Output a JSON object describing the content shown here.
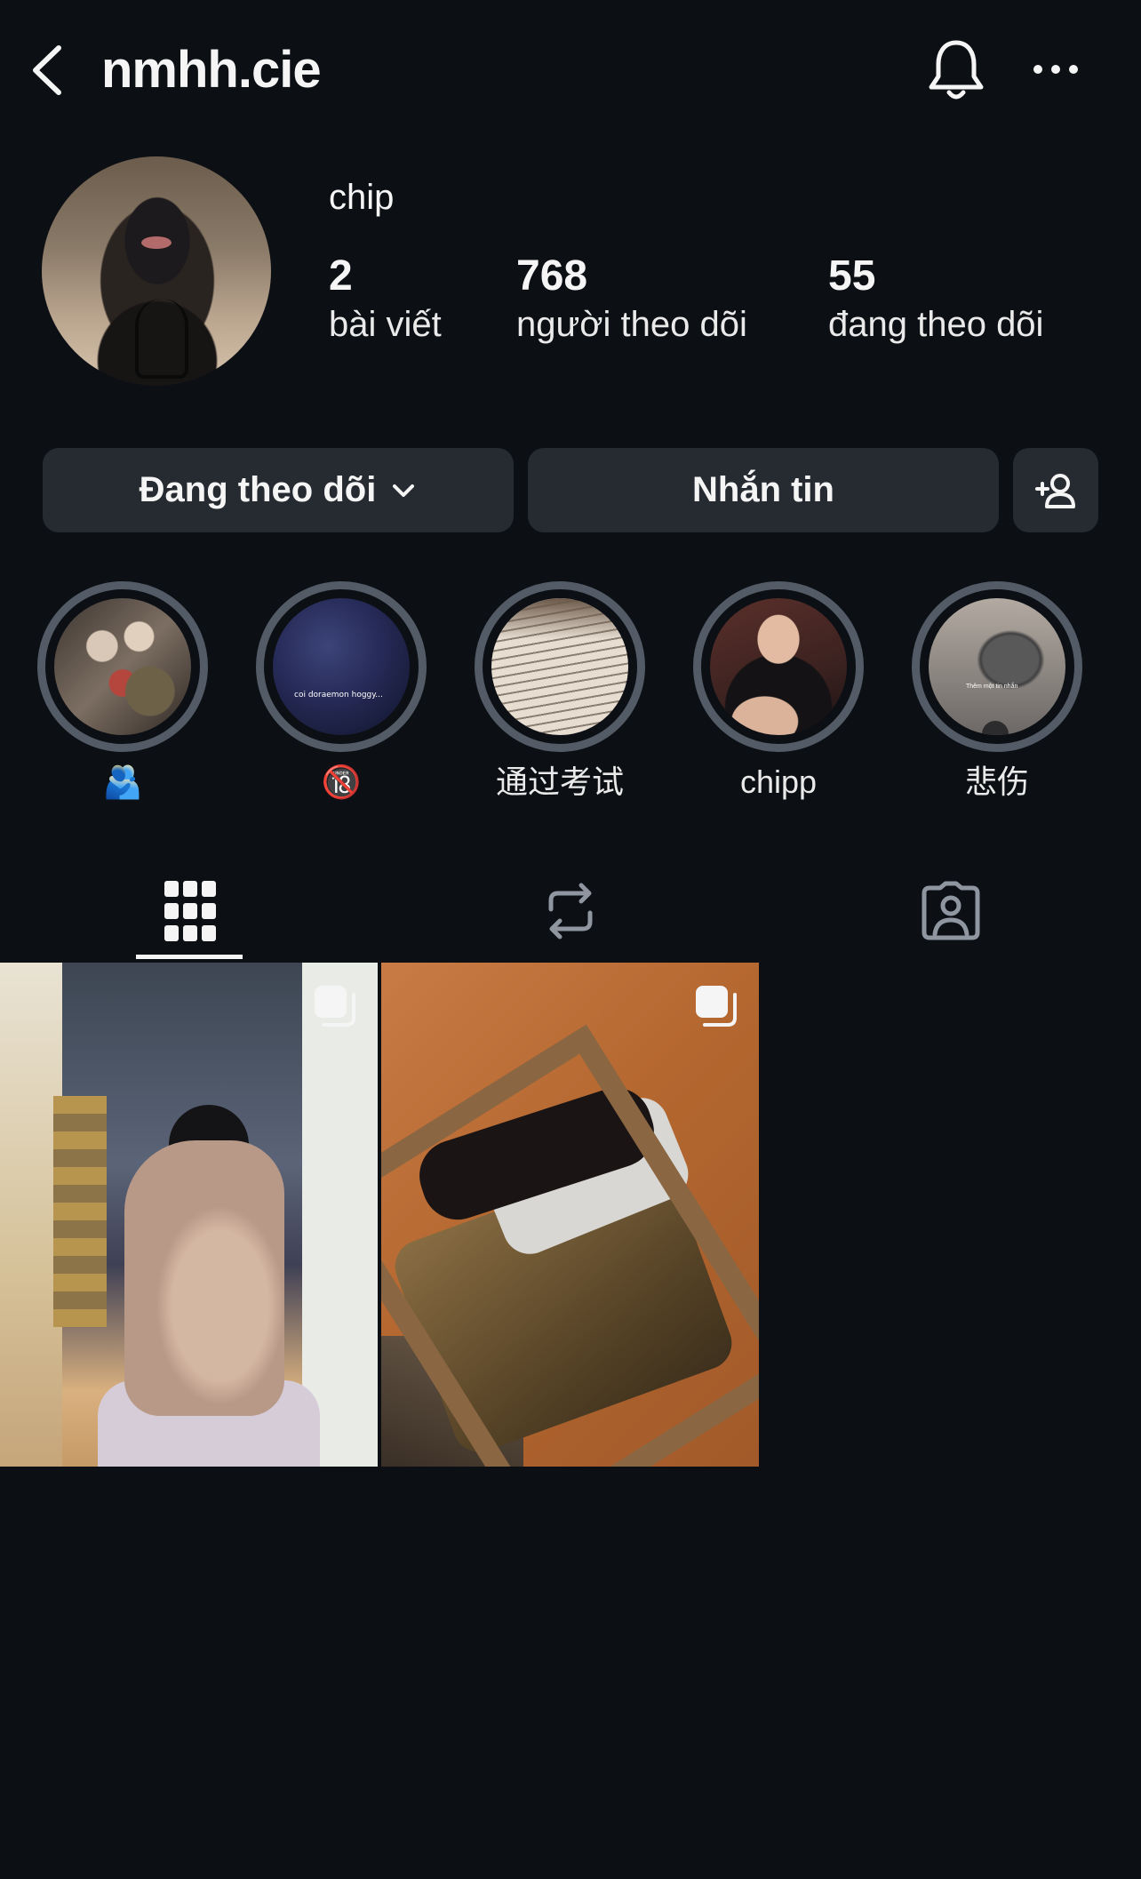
{
  "header": {
    "username": "nmhh.cie"
  },
  "profile": {
    "display_name": "chip",
    "stats": {
      "posts": {
        "count": "2",
        "label": "bài viết"
      },
      "followers": {
        "count": "768",
        "label": "người theo dõi"
      },
      "following": {
        "count": "55",
        "label": "đang theo dõi"
      }
    }
  },
  "actions": {
    "following_label": "Đang theo dõi",
    "message_label": "Nhắn tin"
  },
  "highlights": [
    {
      "label": "🫂"
    },
    {
      "label": "🔞"
    },
    {
      "label": "通过考试"
    },
    {
      "label": "chipp"
    },
    {
      "label": "悲伤"
    }
  ],
  "highlight_texts": {
    "h2_caption": "coi doraemon hoggy...",
    "h5_caption": "Thêm một tin nhắn"
  },
  "tabs": [
    "grid-icon",
    "repost-icon",
    "tagged-icon"
  ],
  "posts": [
    {
      "type": "carousel"
    },
    {
      "type": "carousel"
    }
  ],
  "colors": {
    "background": "#0c0f14",
    "button": "#262a31",
    "highlight_ring": "#535b66",
    "text": "#f5f5f5"
  }
}
